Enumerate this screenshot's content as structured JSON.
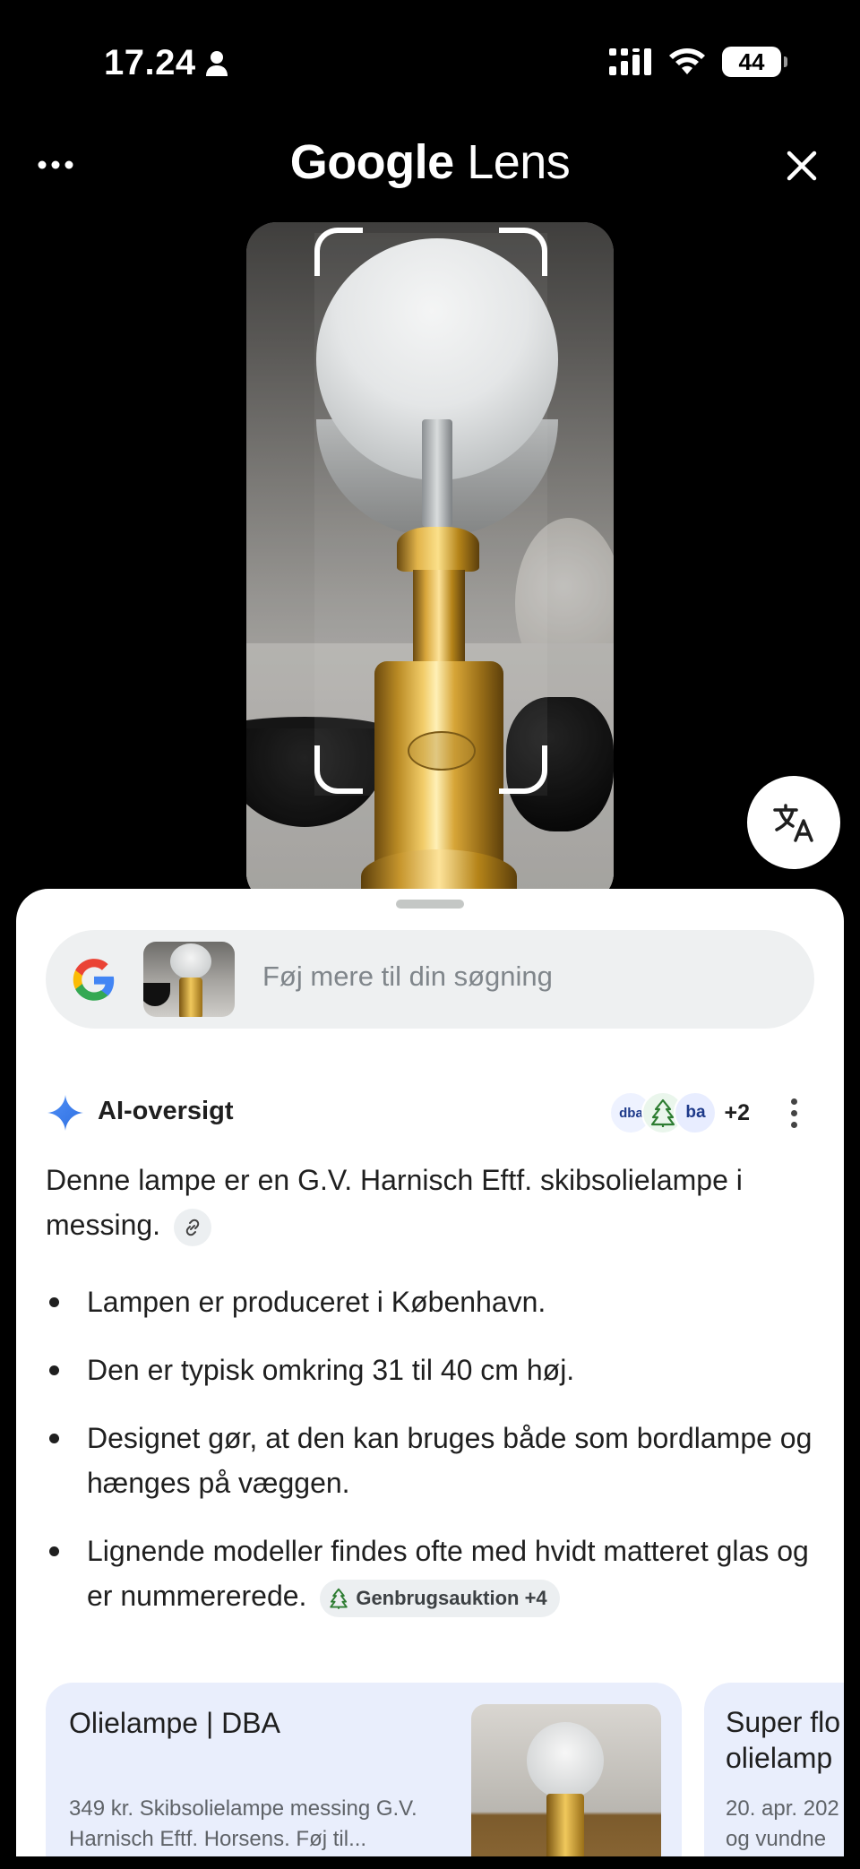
{
  "status": {
    "time": "17.24",
    "battery": "44"
  },
  "header": {
    "title_google": "Google",
    "title_lens": "Lens"
  },
  "search": {
    "placeholder": "Føj mere til din søgning"
  },
  "ai_overview": {
    "title": "AI-oversigt",
    "sources": [
      "dba",
      "ba"
    ],
    "more_sources": "+2",
    "summary": "Denne lampe er en G.V. Harnisch Eftf. skibsolielampe i messing.",
    "bullets": [
      "Lampen er produceret i København.",
      "Den er typisk omkring 31 til 40 cm høj.",
      "Designet gør, at den kan bruges både som bordlampe og hænges på væggen.",
      "Lignende modeller findes ofte med hvidt matteret glas og er nummererede."
    ],
    "source_chip": "Genbrugsauktion +4"
  },
  "results": [
    {
      "title": "Olielampe | DBA",
      "description": "349 kr. Skibsolielampe messing G.V. Harnisch Eftf. Horsens. Føj til..."
    },
    {
      "title": "Super fl… olielamp",
      "title_line1": "Super flo",
      "title_line2": "olielamp",
      "description_line1": "20. apr. 202",
      "description_line2": "og vundne"
    }
  ],
  "colors": {
    "sheet": "#ffffff",
    "card": "#e9eefc",
    "pill": "#eef0f1"
  }
}
